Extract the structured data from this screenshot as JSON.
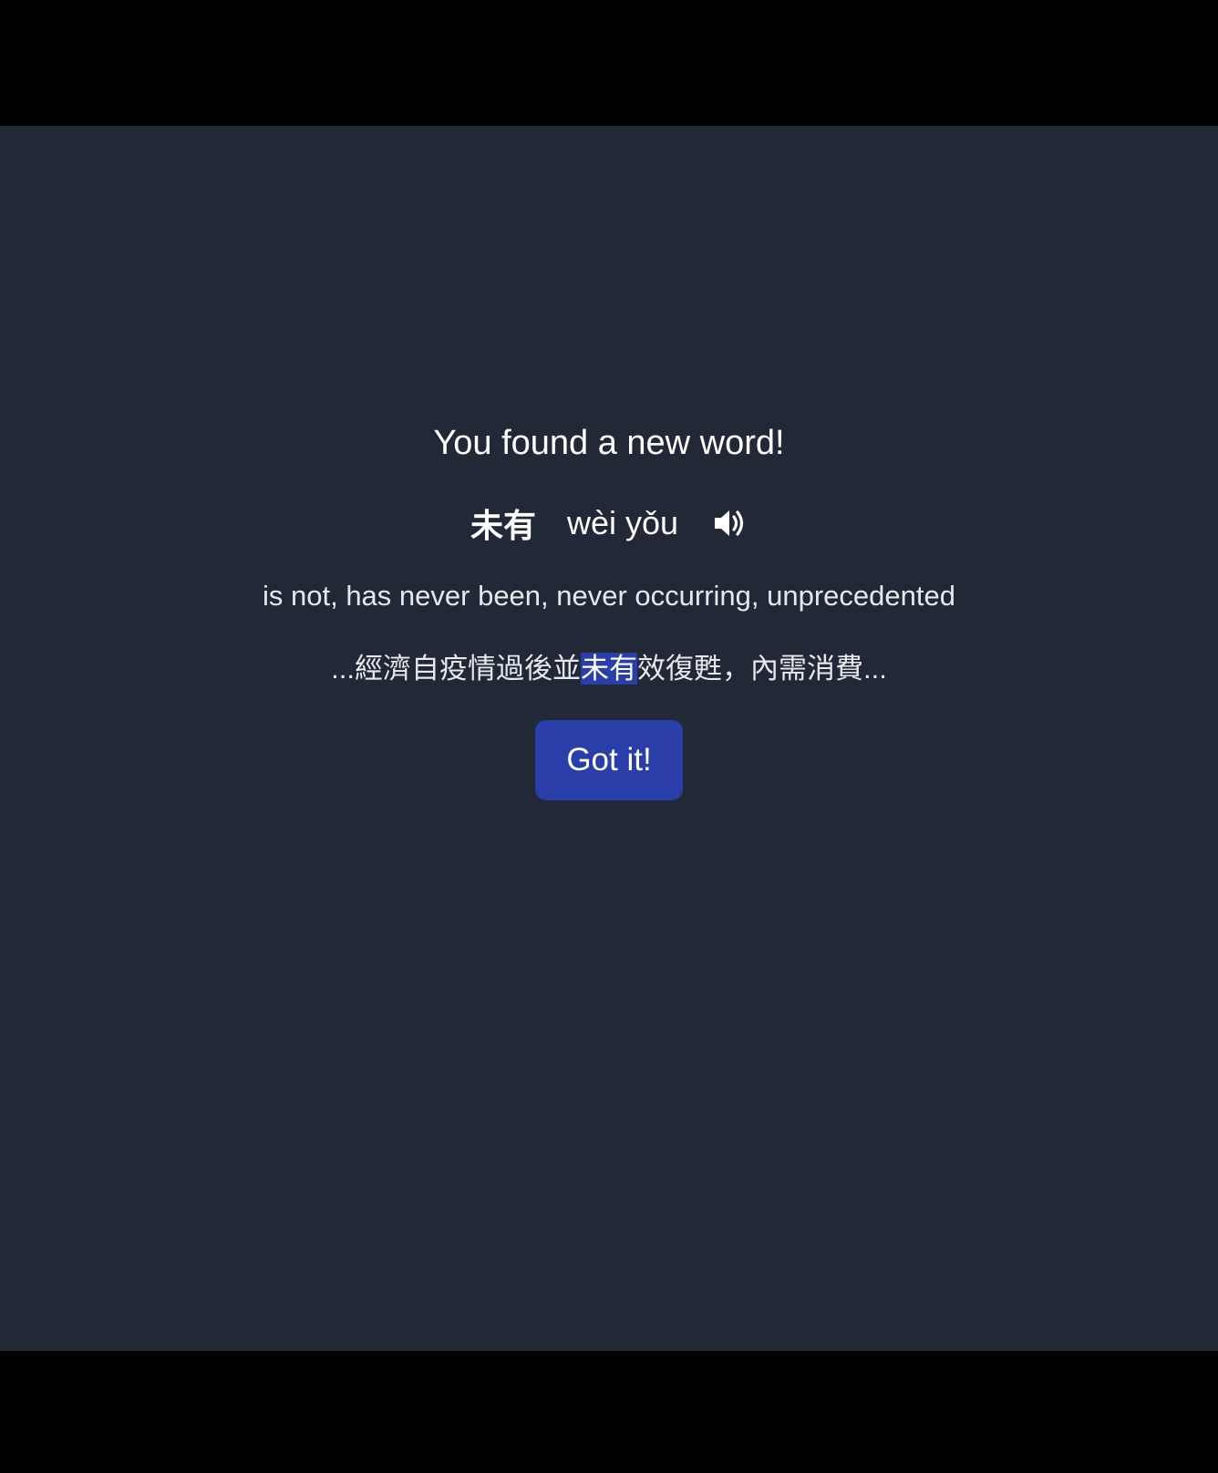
{
  "dialog": {
    "headline": "You found a new word!",
    "word": {
      "hanzi": "未有",
      "pinyin": "wèi yǒu",
      "audio_icon": "speaker-volume-icon"
    },
    "definition": "is not, has never been, never occurring, unprecedented",
    "example": {
      "before": "...經濟自疫情過後並",
      "highlight": "未有",
      "after": "效復甦，內需消費..."
    },
    "button_label": "Got it!"
  },
  "colors": {
    "background": "#212836",
    "letterbox": "#000000",
    "accent": "#2a3eaa",
    "text": "#ffffff"
  }
}
